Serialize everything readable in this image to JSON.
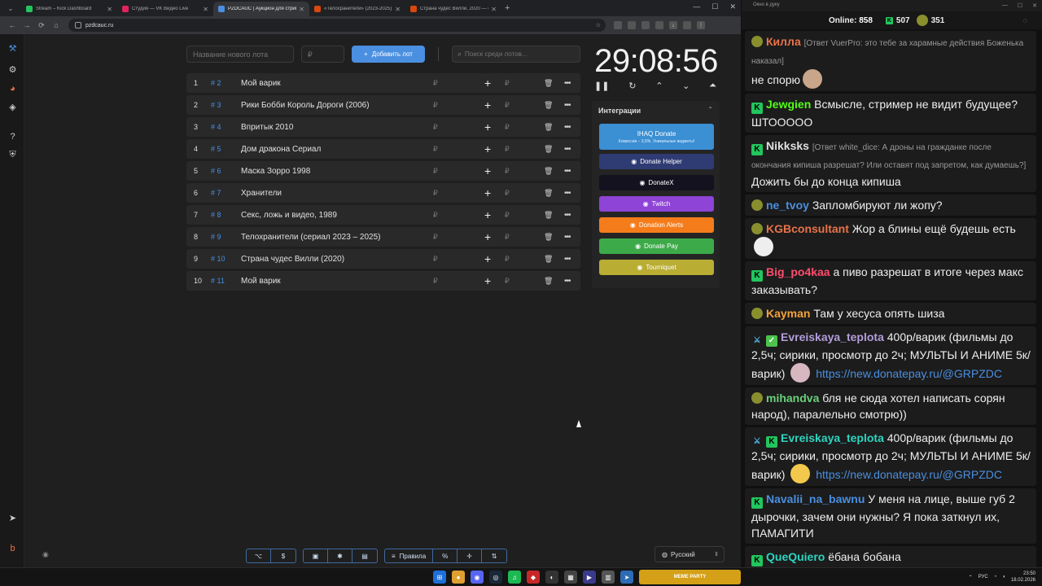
{
  "browser": {
    "tabs": [
      {
        "title": "Stream – Kick Dashboard",
        "color": "#22c55e"
      },
      {
        "title": "Студия — VK Видео Live",
        "color": "#e0245e"
      },
      {
        "title": "PZDCAUC | Аукцион для стрим...",
        "color": "#4a8fe0",
        "active": true
      },
      {
        "title": "«Телохранители» (2023-2025)...",
        "color": "#d9480f"
      },
      {
        "title": "Страна чудес Вилли, 2020 — о...",
        "color": "#d9480f"
      }
    ],
    "url": "pzdcauc.ru"
  },
  "auction": {
    "lot_name_placeholder": "Название нового лота",
    "lot_price_placeholder": "₽",
    "add_lot_label": "Добавить лот",
    "search_placeholder": "Поиск среди лотов...",
    "currency": "₽",
    "lots": [
      {
        "num": "1",
        "id": "# 2",
        "name": "Мой варик"
      },
      {
        "num": "2",
        "id": "# 3",
        "name": "Рики Бобби Король Дороги (2006)"
      },
      {
        "num": "3",
        "id": "# 4",
        "name": "Впритык 2010"
      },
      {
        "num": "4",
        "id": "# 5",
        "name": "Дом дракона Сериал"
      },
      {
        "num": "5",
        "id": "# 6",
        "name": "Маска Зорро 1998"
      },
      {
        "num": "6",
        "id": "# 7",
        "name": "Хранители"
      },
      {
        "num": "7",
        "id": "# 8",
        "name": "Секс, ложь и видео, 1989"
      },
      {
        "num": "8",
        "id": "# 9",
        "name": "Телохранители (сериал 2023 – 2025)"
      },
      {
        "num": "9",
        "id": "# 10",
        "name": "Страна чудес Вилли (2020)"
      },
      {
        "num": "10",
        "id": "# 11",
        "name": "Мой варик"
      }
    ],
    "timer": "29:08:56",
    "integrations": {
      "header": "Интеграции",
      "ihaq_label": "IHAQ Donate",
      "ihaq_sub": "Комиссия – 3,5%. Уникальные виджеты!",
      "buttons": [
        {
          "label": "Donate Helper",
          "color": "#2f3b73"
        },
        {
          "label": "DonateX",
          "color": "#14121f"
        },
        {
          "label": "Twitch",
          "color": "#8e44d6"
        },
        {
          "label": "Donation Alerts",
          "color": "#f57c1b"
        },
        {
          "label": "Donate Pay",
          "color": "#3daa4a"
        },
        {
          "label": "Tourniquet",
          "color": "#b9ad34"
        }
      ]
    },
    "bottom": {
      "rules_label": "Правила",
      "language": "Русский"
    }
  },
  "chat": {
    "window_title": "Окно в дуку",
    "online_label": "Online:",
    "online_count": "858",
    "kick_count": "507",
    "vk_count": "351",
    "messages": [
      {
        "badge": "vk",
        "user": "Килла",
        "color": "#e8734a",
        "reply": "[Ответ VuerPro: это тебе за харамные действия Боженька наказал]",
        "text": "не спорю"
      },
      {
        "badge": "kick",
        "user": "Jewgien",
        "color": "#53fc18",
        "text": "Всмысле, стример не видит будущее? ШТООООО"
      },
      {
        "badge": "kick",
        "user": "Nikksks",
        "color": "#e0e0e0",
        "reply": "[Ответ white_dice: А дроны на гражданке после окончания кипиша разрешат? Или оставят под запретом, как думаешь?]",
        "text": "Дожить бы до конца кипиша"
      },
      {
        "badge": "vk",
        "user": "ne_tvoy",
        "color": "#4a8fe0",
        "text": "Запломбируют ли жопу?"
      },
      {
        "badge": "vk",
        "user": "KGBconsultant",
        "color": "#e8734a",
        "text": "Жор а блины ещё будешь есть"
      },
      {
        "badge": "kick",
        "user": "Big_po4kaa",
        "color": "#ff4d6d",
        "text": "а пиво разрешат в итоге через макс заказывать?"
      },
      {
        "badge": "vk",
        "user": "Kayman",
        "color": "#f2a33a",
        "text": "Там у хесуса опять шиза"
      },
      {
        "badge": "check",
        "user": "Evreiskaya_teplota",
        "color": "#b39ddb",
        "text": "400р/варик (фильмы до 2,5ч; сирики, просмотр до 2ч; МУЛЬТЫ И АНИМЕ 5к/варик)",
        "link": "https://new.donatepay.ru/@GRPZDC"
      },
      {
        "badge": "vk",
        "user": "mihandva",
        "color": "#6bd17a",
        "text": "бля не сюда хотел написать сорян народ), паралельно смотрю))"
      },
      {
        "badge": "kick",
        "user": "Evreiskaya_teplota",
        "color": "#2dd4bf",
        "text": "400р/варик (фильмы до 2,5ч; сирики, просмотр до 2ч; МУЛЬТЫ И АНИМЕ 5к/варик)",
        "link": "https://new.donatepay.ru/@GRPZDC"
      },
      {
        "badge": "kick",
        "user": "Navalii_na_bawnu",
        "color": "#4a8fe0",
        "text": "У меня на лице, выше губ 2 дырочки, зачем они нужны? Я пока заткнул их, ПАМАГИТИ"
      },
      {
        "badge": "kick",
        "user": "QueQuiero",
        "color": "#2dd4bf",
        "text": "ёбана бобана"
      }
    ]
  },
  "taskbar": {
    "meme_label": "MEME PARTY",
    "lang": "РУС",
    "time": "23:50",
    "date": "18.02.2026"
  }
}
